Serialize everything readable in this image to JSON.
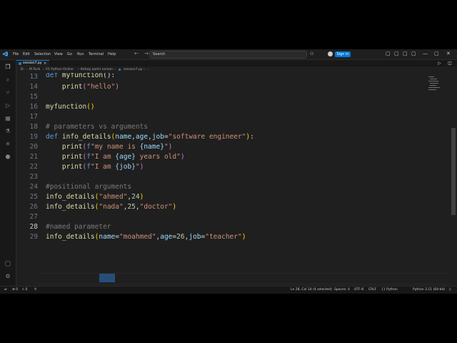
{
  "titlebar": {
    "menu": [
      "File",
      "Edit",
      "Selection",
      "View",
      "Go",
      "Run",
      "Terminal",
      "Help"
    ],
    "search_label": "Search",
    "signin_label": "Sign in",
    "nav_arrows": "← →",
    "icons": [
      "vscode-logo",
      "copilot-icon",
      "account-icon",
      "layout-sidebar-icon",
      "layout-panel-icon",
      "layout-split-icon",
      "customize-layout-icon",
      "minimize-icon",
      "maximize-icon",
      "close-icon"
    ],
    "window_glyphs": {
      "layout1": "▢",
      "layout2": "▢",
      "layout3": "▢",
      "layout4": "▢",
      "minimize": "—",
      "maximize": "▢",
      "close": "✕"
    }
  },
  "activity_bar": {
    "icons": [
      "explorer-icon",
      "search-icon",
      "source-control-icon",
      "run-debug-icon",
      "extensions-icon",
      "testing-icon",
      "copilot-chat-icon",
      "remote-icon",
      "account-icon",
      "settings-gear-icon"
    ],
    "glyphs": [
      "❐",
      "⌕",
      "⑂",
      "▷",
      "▦",
      "⚗",
      "✳",
      "⬟",
      "◯",
      "⚙"
    ]
  },
  "tab": {
    "label": "session7.py",
    "close": "×"
  },
  "editor_actions": {
    "run": "▷",
    "split": "◫",
    "more": "···"
  },
  "breadcrumb": [
    "D:",
    "M.Tech",
    "01 Python Online",
    "Ketaaj aamir osman",
    "session7.py",
    "..."
  ],
  "editor": {
    "line_numbers": [
      "13",
      "14",
      "15",
      "16",
      "17",
      "18",
      "19",
      "20",
      "21",
      "22",
      "23",
      "24",
      "25",
      "26",
      "27",
      "28",
      "29"
    ],
    "active_line": "28",
    "lines": {
      "l13_kw": "def",
      "l13_fn": "myfunction",
      "l13_rest": "():",
      "l14_fn": "print",
      "l14_str": "\"hello\"",
      "l16_fn": "myfunction",
      "l16_rest": "()",
      "l18_cm": "# parameters vs arguments",
      "l19_kw": "def",
      "l19_fn": "info_details",
      "l19_p1": "name",
      "l19_p2": "age",
      "l19_p3": "job",
      "l19_str": "\"software engineer\"",
      "l20_fn": "print",
      "l20_f": "f",
      "l20_s1": "\"my name is ",
      "l20_v": "{name}",
      "l20_s2": "\"",
      "l21_fn": "print",
      "l21_f": "f",
      "l21_s1": "\"I am ",
      "l21_v": "{age}",
      "l21_s2": " years old\"",
      "l22_fn": "print",
      "l22_f": "f",
      "l22_s1": "\"I am ",
      "l22_v": "{job}",
      "l22_s2": "\"",
      "l24_cm": "#positional arguments",
      "l25_fn": "info_details",
      "l25_str": "\"ahmed\"",
      "l25_num": "24",
      "l26_fn": "info_details",
      "l26_str1": "\"nada\"",
      "l26_num": "25",
      "l26_str2": "\"doctor\"",
      "l28_cm": "#named paramet",
      "l28_sel": "er",
      "l29_fn": "info_details",
      "l29_p1": "name",
      "l29_str1": "\"moahmed\"",
      "l29_p2": "age",
      "l29_num": "26",
      "l29_p3": "job",
      "l29_str2": "\"teacher\""
    }
  },
  "statusbar": {
    "errors": "⊗ 0",
    "warnings": "⚠ 0",
    "ports": "⚲",
    "position": "Ln 28, Col 14 (4 selected)",
    "spaces": "Spaces: 4",
    "encoding": "UTF-8",
    "eol": "CRLF",
    "language": "{} Python",
    "interpreter": "Python 3.11 (64-bit)",
    "bell": "♫"
  },
  "colors": {
    "accent": "#0078d4",
    "keyword": "#569cd6",
    "function": "#dcdcaa",
    "string": "#ce9178",
    "number": "#b5cea8",
    "param": "#9cdcfe",
    "comment": "#6a9955"
  }
}
